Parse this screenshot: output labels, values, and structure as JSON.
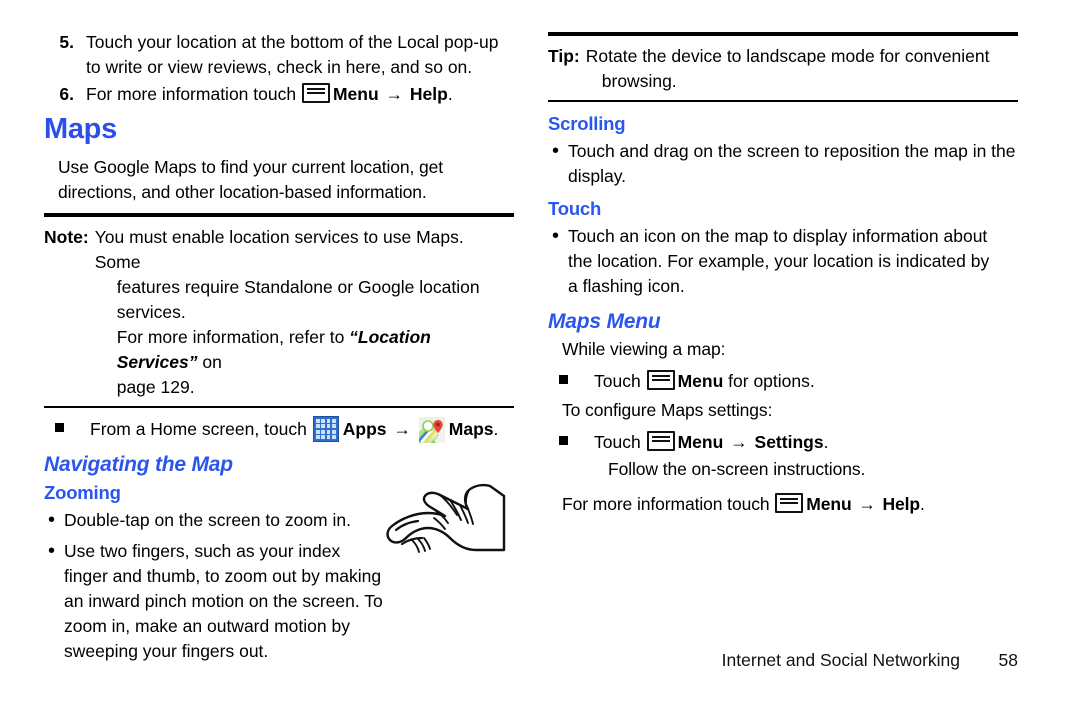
{
  "document": {
    "left_column": {
      "steps": [
        {
          "num": "5.",
          "text": "Touch your location at the bottom of the Local pop-up to write or view reviews, check in here, and so on."
        }
      ],
      "step6": {
        "num": "6.",
        "prefix": "For more information touch",
        "menu_label": "Menu",
        "arrow": "→",
        "target_label": "Help",
        "suffix": "."
      },
      "heading_maps": "Maps",
      "intro": "Use Google Maps to find your current location, get directions, and other location-based information.",
      "note": {
        "label": "Note:",
        "line1": "You must enable location services to use Maps. Some",
        "line2": "features require Standalone or Google location services.",
        "line3_pre": "For more information, refer to ",
        "line3_italic": "“Location Services”",
        "line3_post": " on",
        "line4": "page 129."
      },
      "apps_step": {
        "prefix": "From a Home screen, touch",
        "apps_label": "Apps",
        "arrow": "→",
        "maps_label": "Maps",
        "suffix": "."
      },
      "heading_navigating": "Navigating the Map",
      "heading_zooming": "Zooming",
      "bullets": [
        "Double-tap on the screen to zoom in.",
        "Use two fingers, such as your index finger and thumb, to zoom out by making an inward pinch motion on the screen. To zoom in, make an outward motion by sweeping your fingers out."
      ]
    },
    "right_column": {
      "tip": {
        "label": "Tip:",
        "line1": "Rotate the device to landscape mode for convenient",
        "line2": "browsing."
      },
      "heading_scrolling": "Scrolling",
      "scrolling_bullets": [
        "Touch and drag on the screen to reposition the map in the display."
      ],
      "heading_touch": "Touch",
      "touch_bullets": [
        "Touch an icon on the map to display information about the location. For example, your location is indicated by a flashing icon."
      ],
      "heading_maps_menu": "Maps Menu",
      "while_viewing": "While viewing a map:",
      "menu_options_item": {
        "prefix": "Touch",
        "menu_label": "Menu",
        "suffix": "for options."
      },
      "to_configure": "To configure Maps settings:",
      "settings_item": {
        "prefix": "Touch",
        "menu_label": "Menu",
        "arrow": "→",
        "target_label": "Settings",
        "suffix": "."
      },
      "follow_instructions": "Follow the on-screen instructions.",
      "more_info": {
        "prefix": "For more information touch",
        "menu_label": "Menu",
        "arrow": "→",
        "target_label": "Help",
        "suffix": "."
      }
    },
    "footer": {
      "section": "Internet and Social Networking",
      "page_number": "58"
    },
    "icons": {
      "menu": "menu-icon",
      "apps": "apps-grid-icon",
      "maps": "google-maps-icon",
      "hand": "pinch-hand-illustration"
    },
    "colors": {
      "heading_blue": "#2b4fe8",
      "subheading_blue": "#2b56ee",
      "text_black": "#000000"
    }
  }
}
